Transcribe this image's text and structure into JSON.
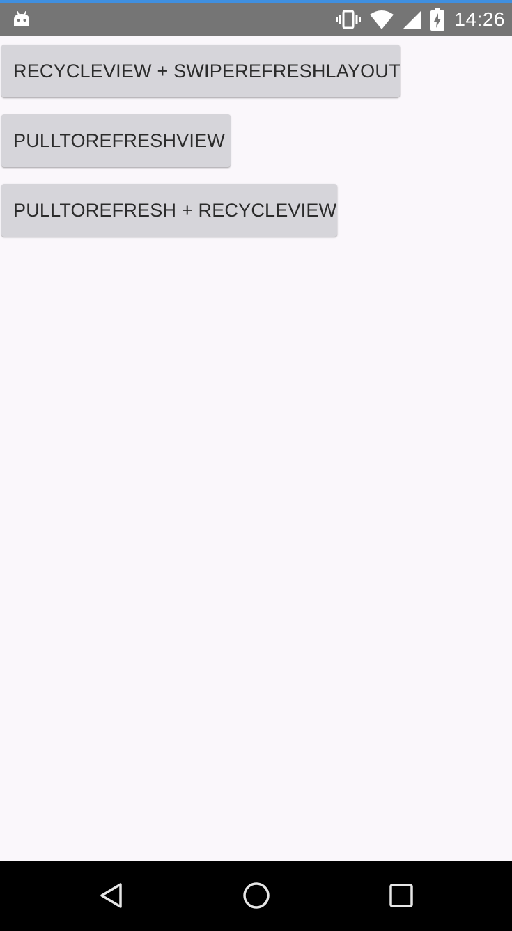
{
  "theme": {
    "accent": "#3f8fe0",
    "status_bar_bg": "#757575",
    "content_bg": "#faf7fb",
    "button_bg": "#d6d5da",
    "nav_bar_bg": "#000000"
  },
  "status_bar": {
    "notification_icon": "android-icon",
    "icons": [
      "vibrate-icon",
      "wifi-icon",
      "cell-signal-icon",
      "battery-charging-icon"
    ],
    "time": "14:26"
  },
  "buttons": [
    {
      "label": "RECYCLEVIEW + SWIPEREFRESHLAYOUT"
    },
    {
      "label": "PULLTOREFRESHVIEW"
    },
    {
      "label": "PULLTOREFRESH + RECYCLEVIEW"
    }
  ],
  "nav_bar": {
    "icons": [
      "back-icon",
      "home-icon",
      "recents-icon"
    ]
  }
}
